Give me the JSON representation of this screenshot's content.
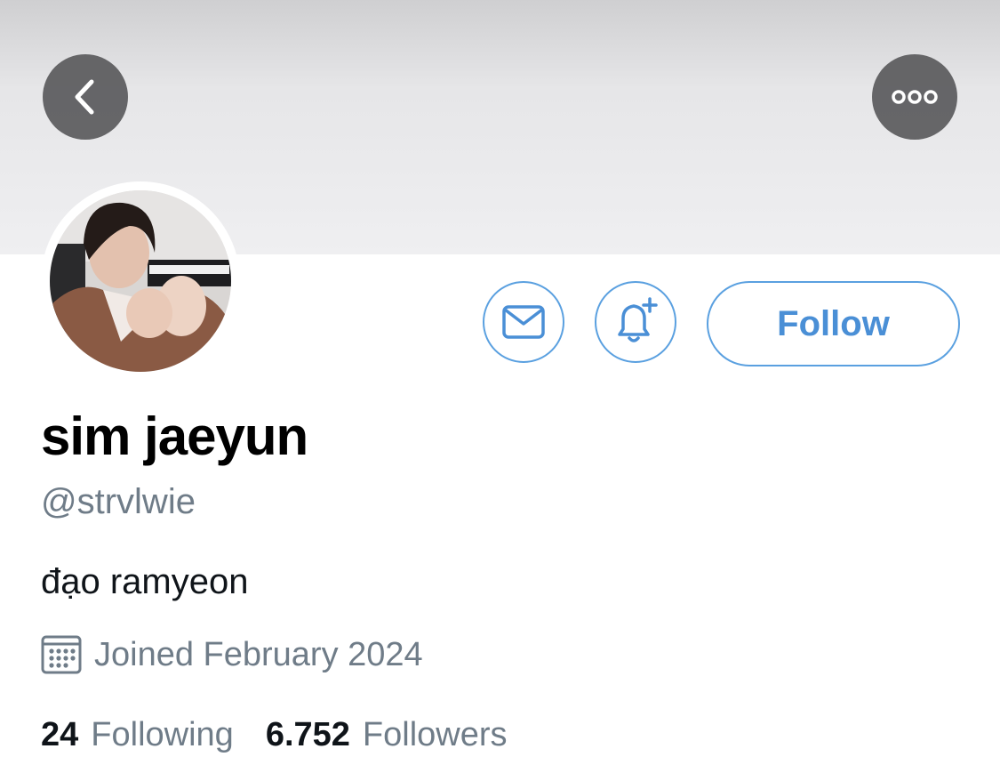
{
  "header": {
    "back_icon": "chevron-left-icon",
    "more_icon": "ellipsis-icon"
  },
  "profile": {
    "display_name": "sim jaeyun",
    "handle": "@strvlwie",
    "bio": "đạo ramyeon",
    "joined": "Joined February 2024",
    "joined_icon": "calendar-icon"
  },
  "actions": {
    "message_icon": "envelope-icon",
    "notify_icon": "bell-plus-icon",
    "follow_label": "Follow"
  },
  "stats": {
    "following_count": "24",
    "following_label": "Following",
    "followers_count": "6.752",
    "followers_label": "Followers"
  },
  "colors": {
    "accent": "#4a8fd6",
    "secondary_text": "#6f7c88"
  }
}
